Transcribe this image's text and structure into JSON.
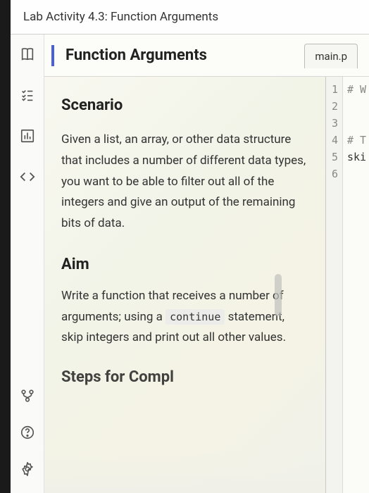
{
  "header": {
    "title": "Lab Activity 4.3: Function Arguments"
  },
  "page_title": "Function Arguments",
  "editor_tab": "main.p",
  "sections": {
    "scenario": {
      "heading": "Scenario",
      "body": "Given a list, an array, or other data structure that includes a number of different data types, you want to be able to filter out all of the integers and give an output of the remaining bits of data."
    },
    "aim": {
      "heading": "Aim",
      "body_pre": "Write a function that receives a number of arguments; using a ",
      "code": "continue",
      "body_post": " statement, skip integers and print out all other values."
    },
    "steps": {
      "heading": "Steps for Compl"
    }
  },
  "code": {
    "lines": [
      {
        "n": "1",
        "text": "# W",
        "cls": "comment"
      },
      {
        "n": "2",
        "text": "",
        "cls": ""
      },
      {
        "n": "3",
        "text": "",
        "cls": ""
      },
      {
        "n": "4",
        "text": "# T",
        "cls": "comment"
      },
      {
        "n": "5",
        "text": "ski",
        "cls": ""
      },
      {
        "n": "6",
        "text": "",
        "cls": ""
      }
    ]
  },
  "icons": {
    "book": "book-icon",
    "checklist": "checklist-icon",
    "chart": "chart-icon",
    "code": "code-icon",
    "branch": "branch-icon",
    "help": "help-icon",
    "settings": "settings-icon"
  }
}
